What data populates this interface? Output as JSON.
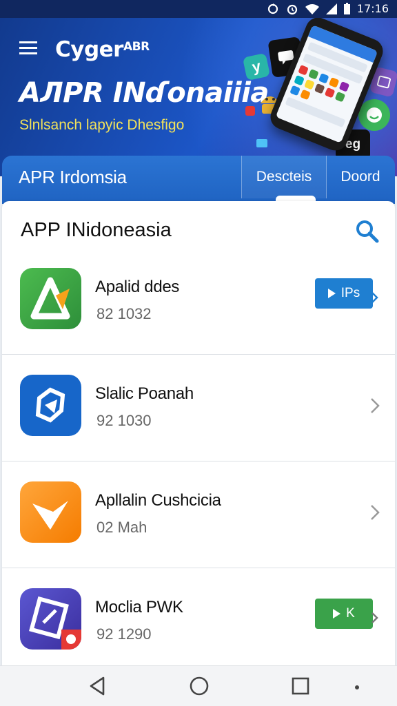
{
  "status_bar": {
    "time": "17:16"
  },
  "hero": {
    "brand": "Cyger",
    "brand_suffix": "ABR",
    "headline": "AЛPR INɗonaiiia",
    "tagline": "Slnlsanch lapyic Dhesfigo",
    "tiles": [
      {
        "label": "y",
        "color": "#29b6a8"
      },
      {
        "label": "",
        "color": "#111111"
      },
      {
        "label": "",
        "color": "#7e57c2"
      },
      {
        "label": "eg",
        "color": "#111111"
      }
    ]
  },
  "tabs_header": {
    "title": "APR Irdomsia",
    "tabs": [
      {
        "label": "Descteis",
        "active": true
      },
      {
        "label": "Doord",
        "active": false
      }
    ]
  },
  "list": {
    "title": "APP INidoneasia",
    "apps": [
      {
        "name": "Apalid ddes",
        "meta": "82 1032",
        "action": "button",
        "action_label": "IPs",
        "icon_color": "#3aa24a",
        "button_color": "#1f7fd1"
      },
      {
        "name": "Slalic Poanah",
        "meta": "92 1030",
        "action": "chevron",
        "icon_color": "#1766c9"
      },
      {
        "name": "Apllalin Cushcicia",
        "meta": "02 Mah",
        "action": "chevron",
        "icon_color": "#f7931e"
      },
      {
        "name": "Moclia PWK",
        "meta": "92 1290",
        "action": "button",
        "action_label": "K",
        "icon_color": "#4a47b5",
        "button_color": "#3aa24a"
      }
    ]
  },
  "colors": {
    "hero_blue": "#1c56c7",
    "tab_blue": "#2b74d3",
    "tagline_yellow": "#f2e25a",
    "search_blue": "#1f7fd1"
  }
}
